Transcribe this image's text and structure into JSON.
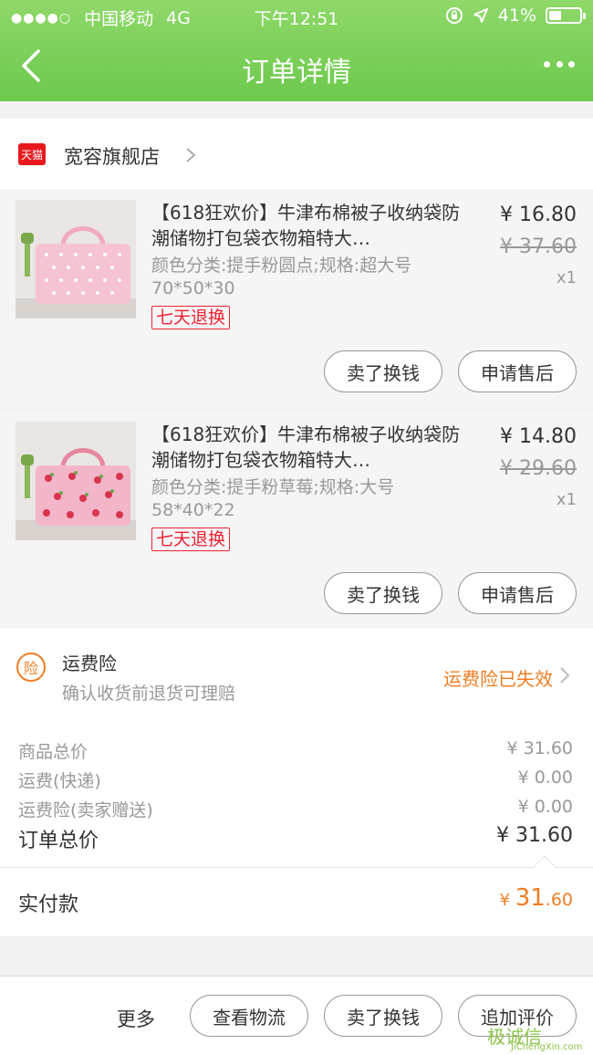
{
  "status_bar": {
    "signal": "●●●●○",
    "carrier": "中国移动",
    "network": "4G",
    "time": "下午12:51",
    "battery": "41%",
    "battery_level": 0.41
  },
  "nav": {
    "title": "订单详情"
  },
  "store": {
    "badge": "天猫",
    "name": "宽容旗舰店"
  },
  "products": [
    {
      "title": "【618狂欢价】牛津布棉被子收纳袋防潮储物打包袋衣物箱特大…",
      "spec": "颜色分类:提手粉圆点;规格:超大号70*50*30",
      "tag": "七天退换",
      "price": "¥ 16.80",
      "orig_price": "¥ 37.60",
      "qty": "x1",
      "btn_sell": "卖了换钱",
      "btn_aftersale": "申请售后"
    },
    {
      "title": "【618狂欢价】牛津布棉被子收纳袋防潮储物打包袋衣物箱特大…",
      "spec": "颜色分类:提手粉草莓;规格:大号58*40*22",
      "tag": "七天退换",
      "price": "¥ 14.80",
      "orig_price": "¥ 29.60",
      "qty": "x1",
      "btn_sell": "卖了换钱",
      "btn_aftersale": "申请售后"
    }
  ],
  "insurance": {
    "icon_text": "险",
    "title": "运费险",
    "subtitle": "确认收货前退货可理赔",
    "status": "运费险已失效"
  },
  "summary": {
    "goods_label": "商品总价",
    "goods_value": "¥ 31.60",
    "shipping_label": "运费(快递)",
    "shipping_value": "¥ 0.00",
    "insurance_label": "运费险(卖家赠送)",
    "insurance_value": "¥ 0.00",
    "total_label": "订单总价",
    "total_value": "¥ 31.60"
  },
  "paid": {
    "label": "实付款",
    "currency": "¥ ",
    "amount_int": "31",
    "amount_dec": ".60"
  },
  "bottom": {
    "more": "更多",
    "logistics": "查看物流",
    "sell": "卖了换钱",
    "review": "追加评价"
  },
  "watermark": {
    "text": "极诚信",
    "url": "JiChengXin.com"
  },
  "colors": {
    "header_green": "#6cc94c",
    "accent_orange": "#f07d22",
    "tmall_red": "#e8191e"
  }
}
